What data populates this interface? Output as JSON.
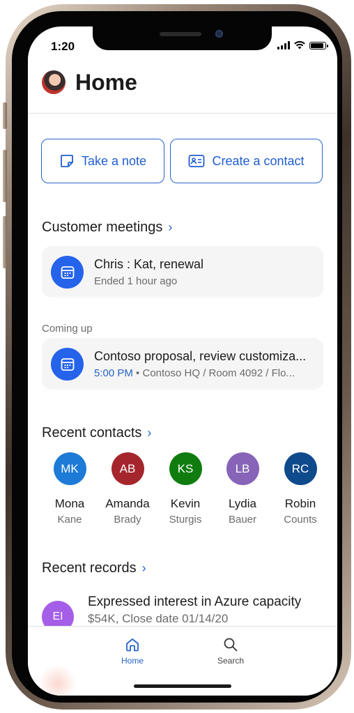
{
  "status_bar": {
    "time": "1:20",
    "signal_icon": "signal-icon",
    "wifi_icon": "wifi-icon",
    "battery_icon": "battery-icon",
    "battery_level": 0.9
  },
  "header": {
    "title": "Home",
    "avatar_icon": "profile-photo"
  },
  "actions": {
    "take_note": {
      "label": "Take a note",
      "icon": "note-icon"
    },
    "create_contact": {
      "label": "Create a contact",
      "icon": "contact-card-icon"
    }
  },
  "customer_meetings": {
    "title": "Customer meetings",
    "recent": {
      "title": "Chris : Kat, renewal",
      "subtitle": "Ended 1 hour ago",
      "icon": "calendar-icon"
    },
    "coming_up_label": "Coming up",
    "upcoming": {
      "title": "Contoso proposal, review customiza...",
      "time": "5:00 PM",
      "location": "Contoso HQ / Room 4092 / Flo...",
      "separator": "•",
      "icon": "calendar-icon"
    }
  },
  "recent_contacts": {
    "title": "Recent contacts",
    "items": [
      {
        "initials": "MK",
        "first": "Mona",
        "last": "Kane",
        "color": "#1d7ad6"
      },
      {
        "initials": "AB",
        "first": "Amanda",
        "last": "Brady",
        "color": "#a4262c"
      },
      {
        "initials": "KS",
        "first": "Kevin",
        "last": "Sturgis",
        "color": "#107c10"
      },
      {
        "initials": "LB",
        "first": "Lydia",
        "last": "Bauer",
        "color": "#8764b8"
      },
      {
        "initials": "RC",
        "first": "Robin",
        "last": "Counts",
        "color": "#0f4a8c"
      }
    ]
  },
  "recent_records": {
    "title": "Recent records",
    "items": [
      {
        "initials": "EI",
        "title": "Expressed interest in Azure capacity",
        "subtitle": "$54K, Close date 01/14/20"
      }
    ]
  },
  "tabbar": {
    "home": {
      "label": "Home",
      "icon": "home-icon"
    },
    "search": {
      "label": "Search",
      "icon": "search-icon"
    }
  },
  "colors": {
    "accent": "#2563c9",
    "meeting_icon_bg": "#2563eb",
    "card_bg": "#f5f5f5"
  }
}
